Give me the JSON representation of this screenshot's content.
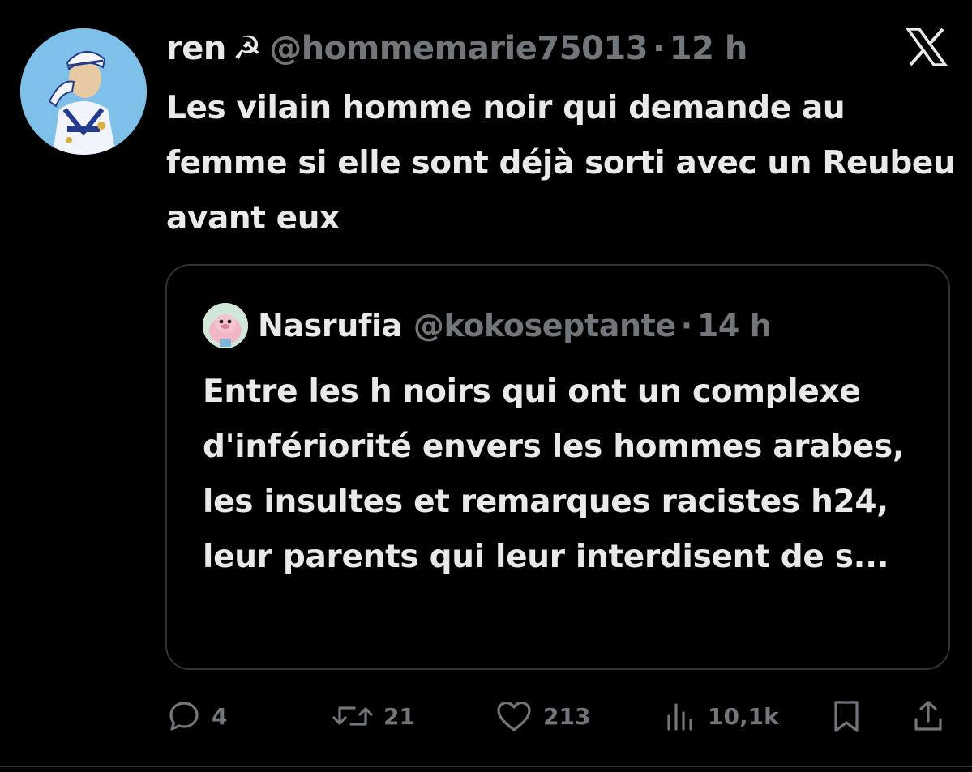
{
  "tweet": {
    "author_name": "ren",
    "author_emoji": "☭",
    "handle": "@hommemarie75013",
    "separator": "·",
    "time": "12 h",
    "text": "Les vilain homme noir qui demande au femme si elle sont déjà sorti avec un Reubeu avant eux"
  },
  "quoted": {
    "author_name": "Nasrufia",
    "handle": "@kokoseptante",
    "separator": "·",
    "time": "14 h",
    "text": "Entre les h noirs qui ont un complexe d'infériorité envers les hommes arabes, les insultes et remarques racistes h24, leur parents qui leur interdisent de s..."
  },
  "actions": {
    "replies": "4",
    "reposts": "21",
    "likes": "213",
    "views": "10,1k"
  },
  "icons": {
    "platform_logo": "x-logo-icon",
    "reply": "reply-icon",
    "repost": "repost-icon",
    "like": "heart-icon",
    "views": "views-bar-chart-icon",
    "bookmark": "bookmark-icon",
    "share": "share-icon"
  },
  "colors": {
    "background": "#000000",
    "primary_text": "#e7e9ea",
    "secondary_text": "#71767b",
    "border": "#2f3336"
  }
}
